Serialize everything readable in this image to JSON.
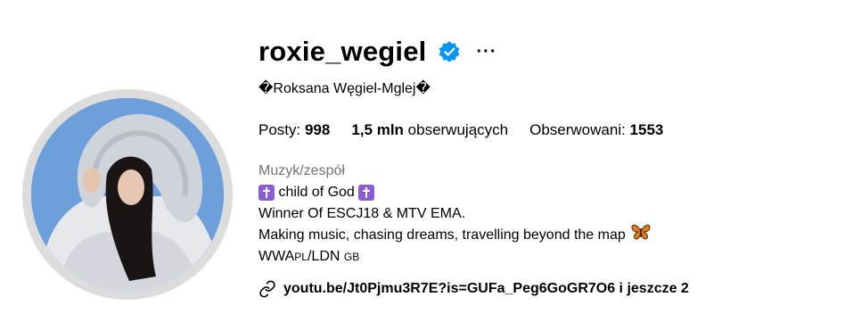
{
  "profile": {
    "username": "roxie_wegiel",
    "more_label": "···",
    "full_name": "�Roksana Węgiel-Mglej�",
    "stats": {
      "posts_label": "Posty: ",
      "posts_value": "998",
      "followers_value": "1,5 mln",
      "followers_label": " obserwujących",
      "following_label": "Obserwowani: ",
      "following_value": "1553"
    },
    "category": "Muzyk/zespół",
    "bio": {
      "line1_text": " child of God ",
      "line2": "Winner Of ESCJ18 & MTV EMA.",
      "line3": "Making music, chasing dreams, travelling beyond the map",
      "line4_a": "WWA",
      "line4_b": "PL",
      "line4_c": "/LDN ",
      "line4_d": "GB"
    },
    "link": {
      "text": "youtu.be/Jt0Pjmu3R7E?is=GUFa_Peg6GoGR7O6 i jeszcze 2"
    },
    "icons": {
      "verified": "verified-badge-icon",
      "cross": "latin-cross-icon",
      "butterfly": "butterfly-icon",
      "link": "link-icon"
    },
    "colors": {
      "verified": "#0095f6",
      "category": "#737373",
      "cross": "#8a5cd6"
    }
  }
}
